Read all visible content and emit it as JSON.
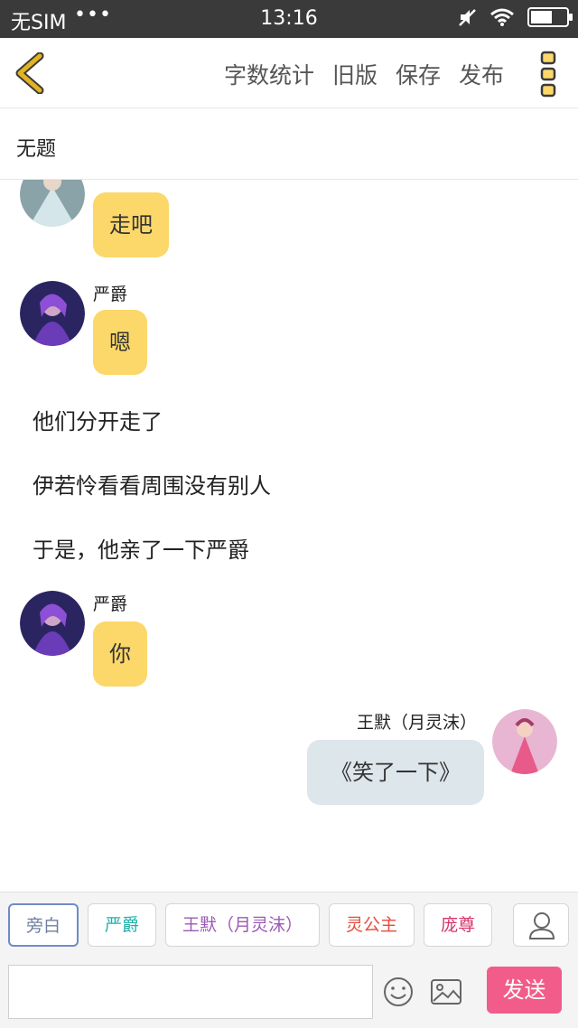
{
  "status_bar": {
    "carrier": "无SIM",
    "dots": "•••",
    "time": "13:16",
    "battery_level": 0.55
  },
  "toolbar": {
    "actions": [
      "字数统计",
      "旧版",
      "保存",
      "发布"
    ],
    "accent_color": "#e2b323"
  },
  "document": {
    "title": "无题"
  },
  "messages": [
    {
      "type": "dialogue",
      "speaker": "",
      "text": "走吧",
      "side": "left"
    },
    {
      "type": "dialogue",
      "speaker": "严爵",
      "text": "嗯",
      "side": "left"
    },
    {
      "type": "narration",
      "text": "他们分开走了"
    },
    {
      "type": "narration",
      "text": "伊若怜看看周围没有别人"
    },
    {
      "type": "narration",
      "text": "于是，他亲了一下严爵"
    },
    {
      "type": "dialogue",
      "speaker": "严爵",
      "text": "你",
      "side": "left"
    },
    {
      "type": "dialogue",
      "speaker": "王默（月灵沫）",
      "text": "《笑了一下》",
      "side": "right"
    }
  ],
  "role_bar": {
    "roles": [
      {
        "label": "旁白",
        "color": "#6f7fa0"
      },
      {
        "label": "严爵",
        "color": "#20b2aa"
      },
      {
        "label": "王默（月灵沫）",
        "color": "#9b59b6"
      },
      {
        "label": "灵公主",
        "color": "#e74c3c"
      },
      {
        "label": "庞尊",
        "color": "#d6336c"
      }
    ]
  },
  "composer": {
    "send_label": "发送",
    "placeholder": ""
  },
  "colors": {
    "bubble_yellow": "#fcd86a",
    "bubble_grey": "#dde6eb",
    "send_pink": "#f25c8a"
  }
}
